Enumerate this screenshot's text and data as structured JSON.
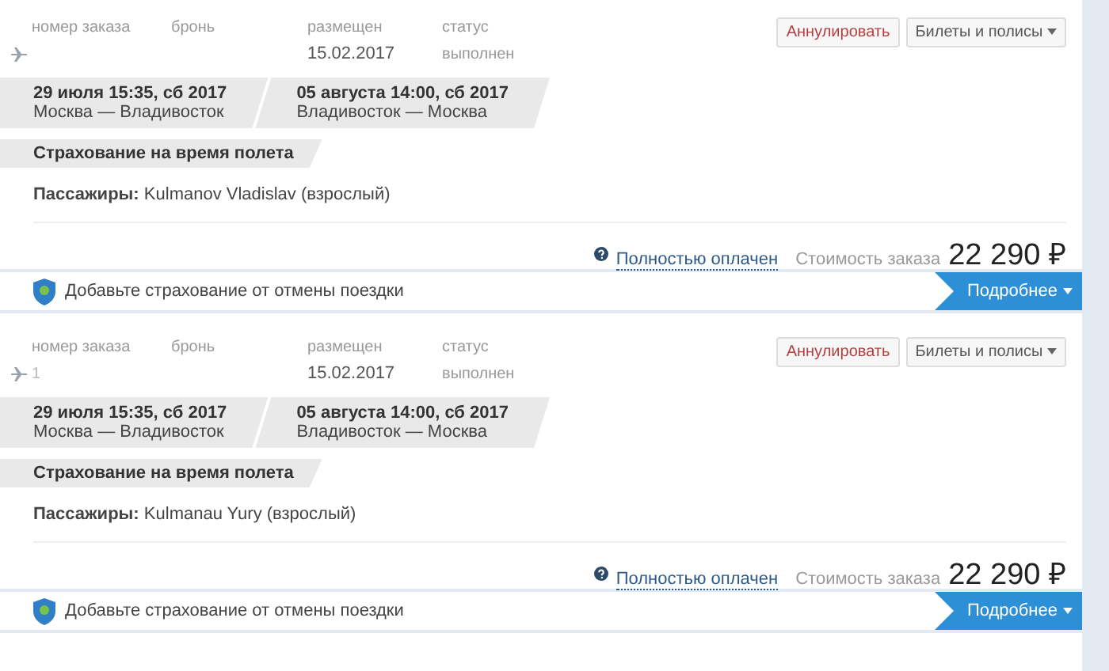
{
  "orders": [
    {
      "labels": [
        "номер заказа",
        "бронь",
        "размещен",
        "статус"
      ],
      "placed": "15.02.2017",
      "status": "выполнен",
      "buttons": {
        "cancel": "Аннулировать",
        "tickets": "Билеты и полисы"
      },
      "segments": [
        {
          "date": "29 июля 15:35, сб 2017",
          "route": "Москва — Владивосток"
        },
        {
          "date": "05 августа 14:00, сб 2017",
          "route": "Владивосток — Москва"
        }
      ],
      "insurance": "Страхование на время полета",
      "passengers_label": "Пассажиры:",
      "passengers": "Kulmanov Vladislav (взрослый)",
      "payment_status": "Полностью оплачен",
      "cost_label": "Стоимость заказа",
      "cost": "22 290 ₽",
      "promo": "Добавьте страхование от отмены поездки",
      "more": "Подробнее"
    },
    {
      "labels": [
        "номер заказа",
        "бронь",
        "размещен",
        "статус"
      ],
      "placed": "15.02.2017",
      "status": "выполнен",
      "order_number": "1",
      "buttons": {
        "cancel": "Аннулировать",
        "tickets": "Билеты и полисы"
      },
      "segments": [
        {
          "date": "29 июля 15:35, сб 2017",
          "route": "Москва — Владивосток"
        },
        {
          "date": "05 августа 14:00, сб 2017",
          "route": "Владивосток — Москва"
        }
      ],
      "insurance": "Страхование на время полета",
      "passengers_label": "Пассажиры:",
      "passengers": "Kulmanau Yury (взрослый)",
      "payment_status": "Полностью оплачен",
      "cost_label": "Стоимость заказа",
      "cost": "22 290 ₽",
      "promo": "Добавьте страхование от отмены поездки",
      "more": "Подробнее"
    }
  ]
}
